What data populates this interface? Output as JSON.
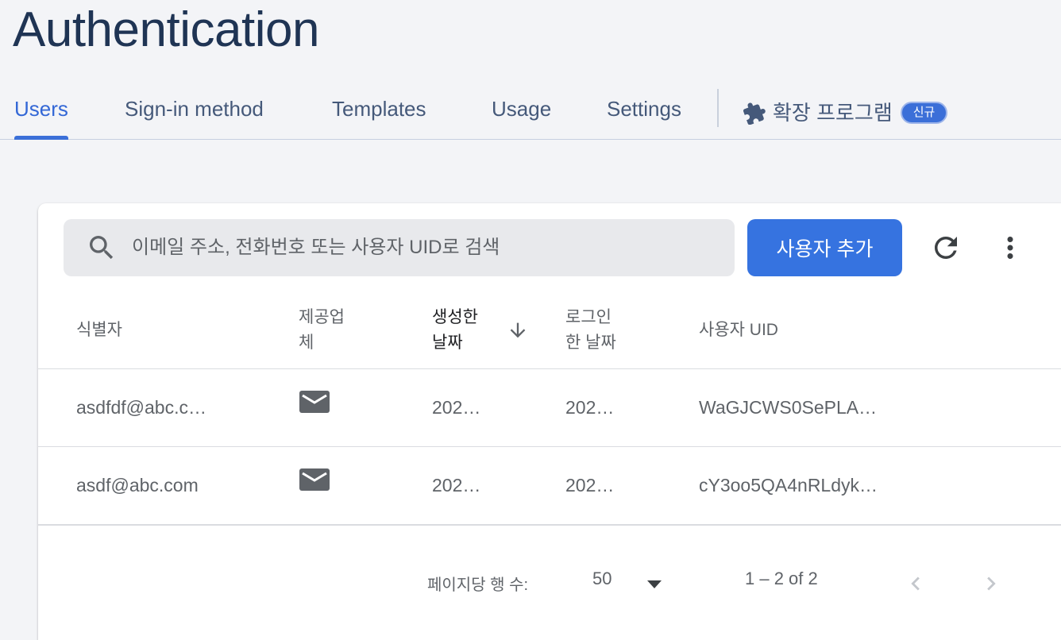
{
  "page": {
    "title": "Authentication"
  },
  "tabs": [
    {
      "label": "Users",
      "active": true
    },
    {
      "label": "Sign-in method",
      "active": false
    },
    {
      "label": "Templates",
      "active": false
    },
    {
      "label": "Usage",
      "active": false
    },
    {
      "label": "Settings",
      "active": false
    }
  ],
  "extensions_tab": {
    "label": "확장 프로그램",
    "badge": "신규",
    "icon": "puzzle-icon"
  },
  "search": {
    "placeholder": "이메일 주소, 전화번호 또는 사용자 UID로 검색",
    "value": ""
  },
  "toolbar": {
    "add_user_label": "사용자 추가",
    "refresh_icon": "refresh-icon",
    "more_icon": "more-vert-icon"
  },
  "table": {
    "columns": [
      {
        "line1": "식별자",
        "line2": ""
      },
      {
        "line1": "제공업",
        "line2": "체"
      },
      {
        "line1": "생성한",
        "line2": "날짜",
        "sorted": "desc"
      },
      {
        "line1": "로그인",
        "line2": "한 날짜"
      },
      {
        "line1": "사용자 UID",
        "line2": ""
      }
    ],
    "rows": [
      {
        "identifier": "asdfdf@abc.c…",
        "provider_icon": "email-icon",
        "created": "202…",
        "signed_in": "202…",
        "uid": "WaGJCWS0SePLA…"
      },
      {
        "identifier": "asdf@abc.com",
        "provider_icon": "email-icon",
        "created": "202…",
        "signed_in": "202…",
        "uid": "cY3oo5QA4nRLdyk…"
      }
    ]
  },
  "pagination": {
    "rows_per_page_label": "페이지당 행 수:",
    "rows_per_page": "50",
    "range": "1 – 2 of 2"
  },
  "colors": {
    "accent": "#3673e0",
    "title": "#1f3454",
    "tab_text": "#45597a"
  }
}
